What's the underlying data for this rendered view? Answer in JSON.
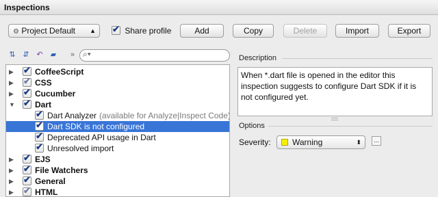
{
  "title": "Inspections",
  "profile": {
    "selected": "Project Default",
    "share_label": "Share profile",
    "share_checked": true
  },
  "buttons": {
    "add": "Add",
    "copy": "Copy",
    "delete": "Delete",
    "import": "Import",
    "export": "Export"
  },
  "toolbar": {
    "more": "»",
    "search_placeholder": ""
  },
  "tree": [
    {
      "label": "CoffeeScript",
      "bold": true,
      "expanded": false,
      "checked": true,
      "depth": 0
    },
    {
      "label": "CSS",
      "bold": true,
      "expanded": false,
      "checked": true,
      "partial": true,
      "depth": 0
    },
    {
      "label": "Cucumber",
      "bold": true,
      "expanded": false,
      "checked": true,
      "depth": 0
    },
    {
      "label": "Dart",
      "bold": true,
      "expanded": true,
      "checked": true,
      "depth": 0
    },
    {
      "label": "Dart Analyzer",
      "note": "(available for Analyze|Inspect Code)",
      "checked": true,
      "depth": 1
    },
    {
      "label": "Dart SDK is not configured",
      "checked": true,
      "selected": true,
      "depth": 1
    },
    {
      "label": "Deprecated API usage in Dart",
      "checked": true,
      "depth": 1
    },
    {
      "label": "Unresolved import",
      "checked": true,
      "depth": 1
    },
    {
      "label": "EJS",
      "bold": true,
      "expanded": false,
      "checked": true,
      "depth": 0
    },
    {
      "label": "File Watchers",
      "bold": true,
      "expanded": false,
      "checked": true,
      "depth": 0
    },
    {
      "label": "General",
      "bold": true,
      "expanded": false,
      "checked": true,
      "depth": 0
    },
    {
      "label": "HTML",
      "bold": true,
      "expanded": false,
      "checked": true,
      "partial": true,
      "depth": 0
    }
  ],
  "description": {
    "label": "Description",
    "text": "When *.dart file is opened in the editor this inspection suggests to configure Dart SDK if it is not configured yet."
  },
  "options": {
    "label": "Options",
    "severity_label": "Severity:",
    "severity_value": "Warning",
    "more_button": "..."
  },
  "colors": {
    "selection": "#3875d7",
    "warning_swatch": "#f7f000"
  }
}
